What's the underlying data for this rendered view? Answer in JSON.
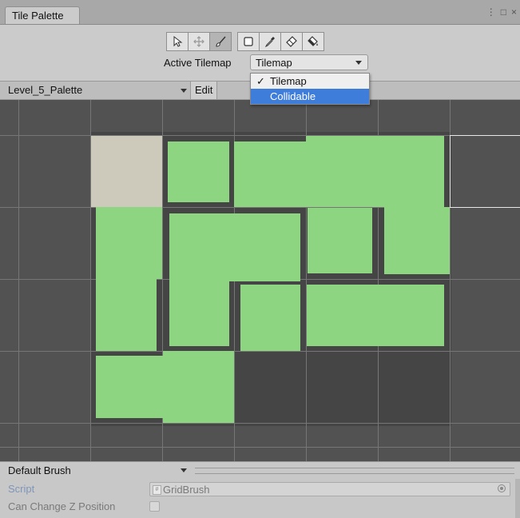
{
  "window": {
    "tab_title": "Tile Palette",
    "controls": {
      "menu": "⋮",
      "maximize": "□",
      "close": "×"
    }
  },
  "toolbar": {
    "tools": [
      {
        "icon": "select-arrow-icon",
        "active": false
      },
      {
        "icon": "move-icon",
        "active": false
      },
      {
        "icon": "paintbrush-icon",
        "active": true
      },
      {
        "icon": "box-fill-icon",
        "active": false
      },
      {
        "icon": "eyedropper-icon",
        "active": false
      },
      {
        "icon": "eraser-icon",
        "active": false
      },
      {
        "icon": "flood-fill-icon",
        "active": false
      }
    ],
    "active_tilemap_label": "Active Tilemap",
    "active_tilemap_value": "Tilemap"
  },
  "dropdown": {
    "options": [
      {
        "label": "Tilemap",
        "checked": true,
        "highlighted": false
      },
      {
        "label": "Collidable",
        "checked": false,
        "highlighted": true
      }
    ]
  },
  "palette_bar": {
    "palette_name": "Level_5_Palette",
    "edit_label": "Edit"
  },
  "brush": {
    "name": "Default Brush",
    "script_label": "Script",
    "script_value": "GridBrush",
    "script_badge": "#",
    "z_label": "Can Change Z Position",
    "z_checked": false
  },
  "colors": {
    "tile_green": "#8ed582",
    "tile_beige": "#cdcabb",
    "canvas_bg": "#525252",
    "highlight_blue": "#3f7ddb"
  }
}
